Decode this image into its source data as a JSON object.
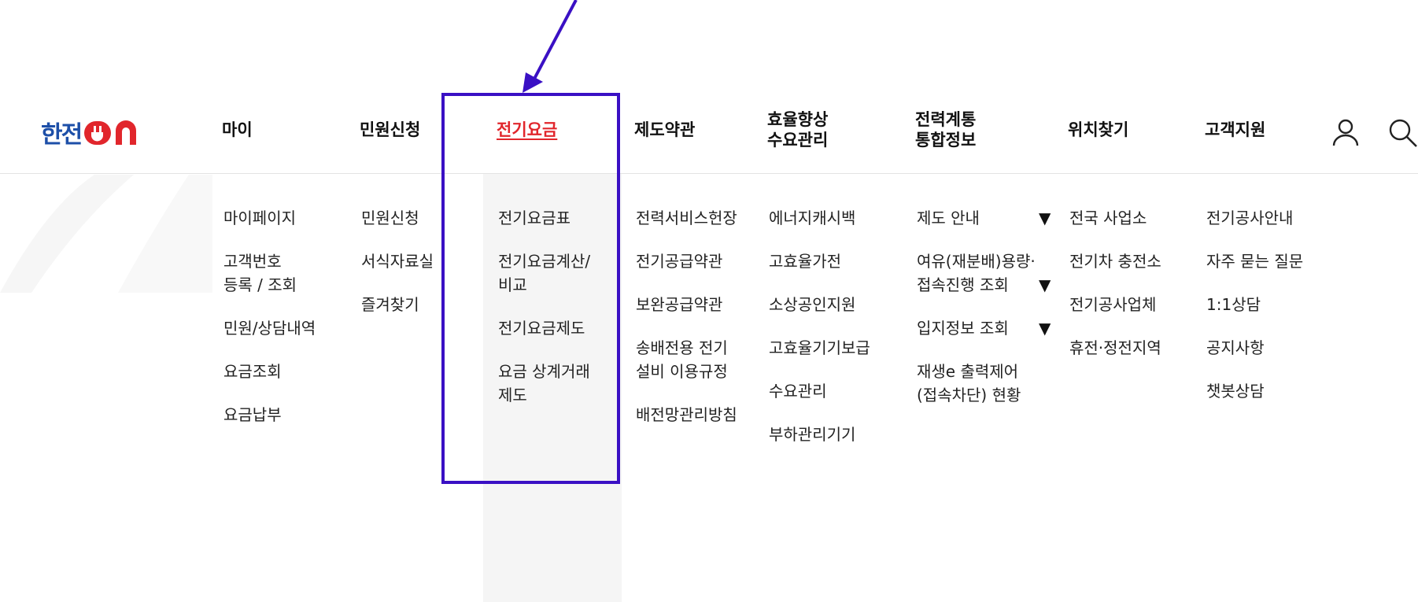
{
  "brand": {
    "logo_kr": "한전",
    "logo_on": "ON",
    "accent_blue": "#1d4fa8",
    "accent_red": "#e1262c"
  },
  "nav": {
    "items": [
      {
        "lines": [
          "마이"
        ]
      },
      {
        "lines": [
          "민원신청"
        ]
      },
      {
        "lines": [
          "전기요금"
        ],
        "active": true
      },
      {
        "lines": [
          "제도약관"
        ]
      },
      {
        "lines": [
          "효율향상",
          "수요관리"
        ]
      },
      {
        "lines": [
          "전력계통",
          "통합정보"
        ]
      },
      {
        "lines": [
          "위치찾기"
        ]
      },
      {
        "lines": [
          "고객지원"
        ]
      }
    ]
  },
  "icons": {
    "user": "user-icon",
    "search": "search-icon"
  },
  "mega_menu": {
    "columns": [
      [
        [
          "마이페이지"
        ],
        [
          "고객번호",
          "등록 / 조회"
        ],
        [
          "민원/상담내역"
        ],
        [
          "요금조회"
        ],
        [
          "요금납부"
        ]
      ],
      [
        [
          "민원신청"
        ],
        [
          "서식자료실"
        ],
        [
          "즐겨찾기"
        ]
      ],
      [
        [
          "전기요금표"
        ],
        [
          "전기요금계산/",
          "비교"
        ],
        [
          "전기요금제도"
        ],
        [
          "요금 상계거래",
          "제도"
        ]
      ],
      [
        [
          "전력서비스헌장"
        ],
        [
          "전기공급약관"
        ],
        [
          "보완공급약관"
        ],
        [
          "송배전용 전기",
          "설비 이용규정"
        ],
        [
          "배전망관리방침"
        ]
      ],
      [
        [
          "에너지캐시백"
        ],
        [
          "고효율가전"
        ],
        [
          "소상공인지원"
        ],
        [
          "고효율기기보급"
        ],
        [
          "수요관리"
        ],
        [
          "부하관리기기"
        ]
      ],
      [
        [
          "제도 안내"
        ],
        [
          "여유(재분배)용량·",
          "접속진행 조회"
        ],
        [
          "입지정보 조회"
        ],
        [
          "재생e 출력제어",
          "(접속차단) 현황"
        ]
      ],
      [
        [
          "전국 사업소"
        ],
        [
          "전기차 충전소"
        ],
        [
          "전기공사업체"
        ],
        [
          "휴전·정전지역"
        ]
      ],
      [
        [
          "전기공사안내"
        ],
        [
          "자주 묻는 질문"
        ],
        [
          "1:1상담"
        ],
        [
          "공지사항"
        ],
        [
          "챗봇상담"
        ]
      ]
    ],
    "expand_glyph": "▼"
  },
  "annotation_color": "#3a10c4"
}
